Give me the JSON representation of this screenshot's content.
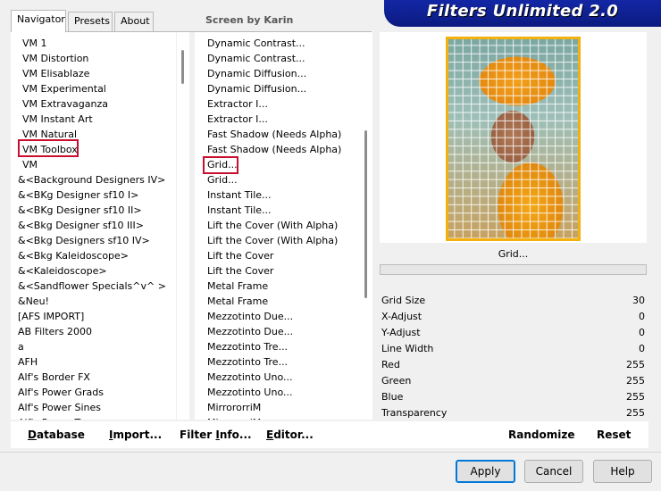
{
  "tabs": [
    "Navigator",
    "Presets",
    "About"
  ],
  "screen_credit": "Screen by Karin",
  "banner_title": "Filters Unlimited 2.0",
  "categories": [
    "VM 1",
    "VM Distortion",
    "VM Elisablaze",
    "VM Experimental",
    "VM Extravaganza",
    "VM Instant Art",
    "VM Natural",
    "VM Toolbox",
    "VM",
    "&<Background Designers IV>",
    "&<BKg Designer sf10 I>",
    "&<BKg Designer sf10 II>",
    "&<Bkg Designer sf10 III>",
    "&<Bkg Designers sf10 IV>",
    "&<Bkg Kaleidoscope>",
    "&<Kaleidoscope>",
    "&<Sandflower Specials^v^ >",
    "&Neu!",
    "[AFS IMPORT]",
    "AB Filters 2000",
    "a",
    "AFH",
    "Alf's Border FX",
    "Alf's Power Grads",
    "Alf's Power Sines",
    "Alf's Power Toys"
  ],
  "filters": [
    "Dynamic Contrast...",
    "Dynamic Contrast...",
    "Dynamic Diffusion...",
    "Dynamic Diffusion...",
    "Extractor I...",
    "Extractor I...",
    "Fast Shadow (Needs Alpha)",
    "Fast Shadow (Needs Alpha)",
    "Grid...",
    "Grid...",
    "Instant Tile...",
    "Instant Tile...",
    "Lift the Cover (With Alpha)",
    "Lift the Cover (With Alpha)",
    "Lift the Cover",
    "Lift the Cover",
    "Metal Frame",
    "Metal Frame",
    "Mezzotinto Due...",
    "Mezzotinto Due...",
    "Mezzotinto Tre...",
    "Mezzotinto Tre...",
    "Mezzotinto Uno...",
    "Mezzotinto Uno...",
    "MirrororriM",
    "MirrororriM"
  ],
  "selected_category": "VM Toolbox",
  "selected_filter": "Grid...",
  "preview_filter_label": "Grid...",
  "params": [
    {
      "name": "Grid Size",
      "value": "30"
    },
    {
      "name": "X-Adjust",
      "value": "0"
    },
    {
      "name": "Y-Adjust",
      "value": "0"
    },
    {
      "name": "Line Width",
      "value": "0"
    },
    {
      "name": "Red",
      "value": "255"
    },
    {
      "name": "Green",
      "value": "255"
    },
    {
      "name": "Blue",
      "value": "255"
    },
    {
      "name": "Transparency",
      "value": "255"
    }
  ],
  "bottom_buttons": {
    "database": {
      "underline": "D",
      "rest": "atabase"
    },
    "import": {
      "underline": "I",
      "rest": "mport..."
    },
    "filter_info": {
      "pre": "Filter ",
      "underline": "I",
      "rest": "nfo..."
    },
    "editor": {
      "underline": "E",
      "rest": "ditor..."
    },
    "randomize": "Randomize",
    "reset": "Reset"
  },
  "dialog_buttons": {
    "apply": "Apply",
    "cancel": "Cancel",
    "help": "Help"
  },
  "colors": {
    "highlight": "#c8102e",
    "banner": "#1327a5",
    "frame": "#f2b10f"
  }
}
